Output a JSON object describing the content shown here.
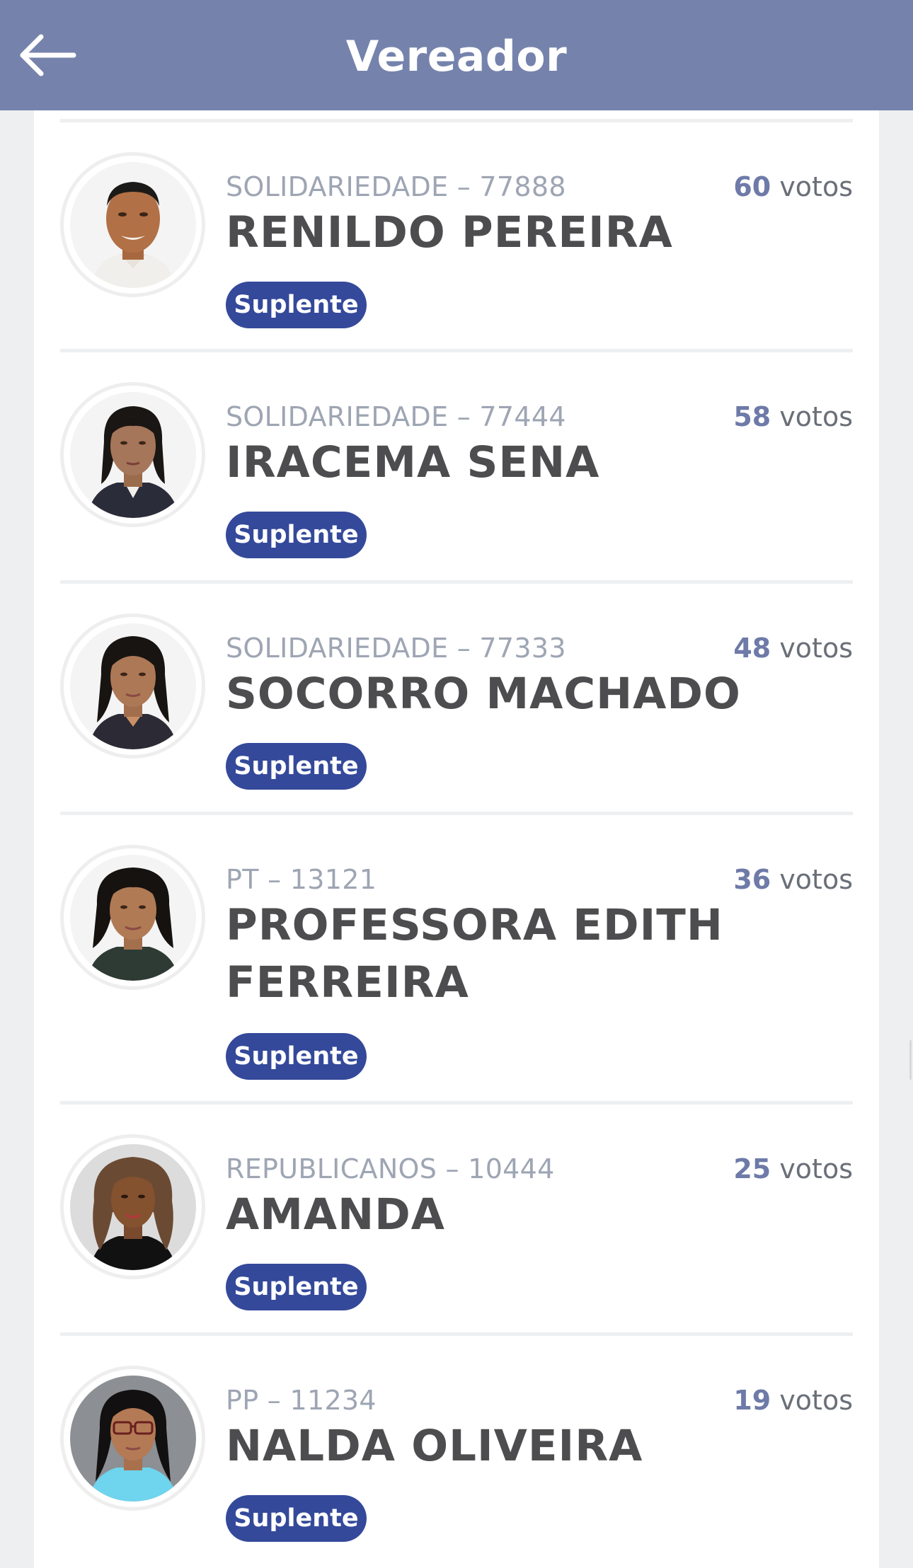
{
  "header": {
    "title": "Vereador",
    "back_icon": "arrow-left-icon"
  },
  "candidates": [
    {
      "party": "SOLIDARIEDADE – 77888",
      "name": "RENILDO PEREIRA",
      "status": "Suplente",
      "votes_number": "60",
      "votes_label": "votos"
    },
    {
      "party": "SOLIDARIEDADE – 77444",
      "name": "IRACEMA SENA",
      "status": "Suplente",
      "votes_number": "58",
      "votes_label": "votos"
    },
    {
      "party": "SOLIDARIEDADE – 77333",
      "name": "SOCORRO MACHADO",
      "status": "Suplente",
      "votes_number": "48",
      "votes_label": "votos"
    },
    {
      "party": "PT – 13121",
      "name": "PROFESSORA EDITH FERREIRA",
      "status": "Suplente",
      "votes_number": "36",
      "votes_label": "votos"
    },
    {
      "party": "REPUBLICANOS – 10444",
      "name": "AMANDA",
      "status": "Suplente",
      "votes_number": "25",
      "votes_label": "votos"
    },
    {
      "party": "PP – 11234",
      "name": "NALDA OLIVEIRA",
      "status": "Suplente",
      "votes_number": "19",
      "votes_label": "votos"
    }
  ],
  "colors": {
    "header_bg": "#7583ac",
    "badge_bg": "#34499a",
    "votes_number": "#6e7aa8",
    "page_bg": "#eeeff1"
  }
}
